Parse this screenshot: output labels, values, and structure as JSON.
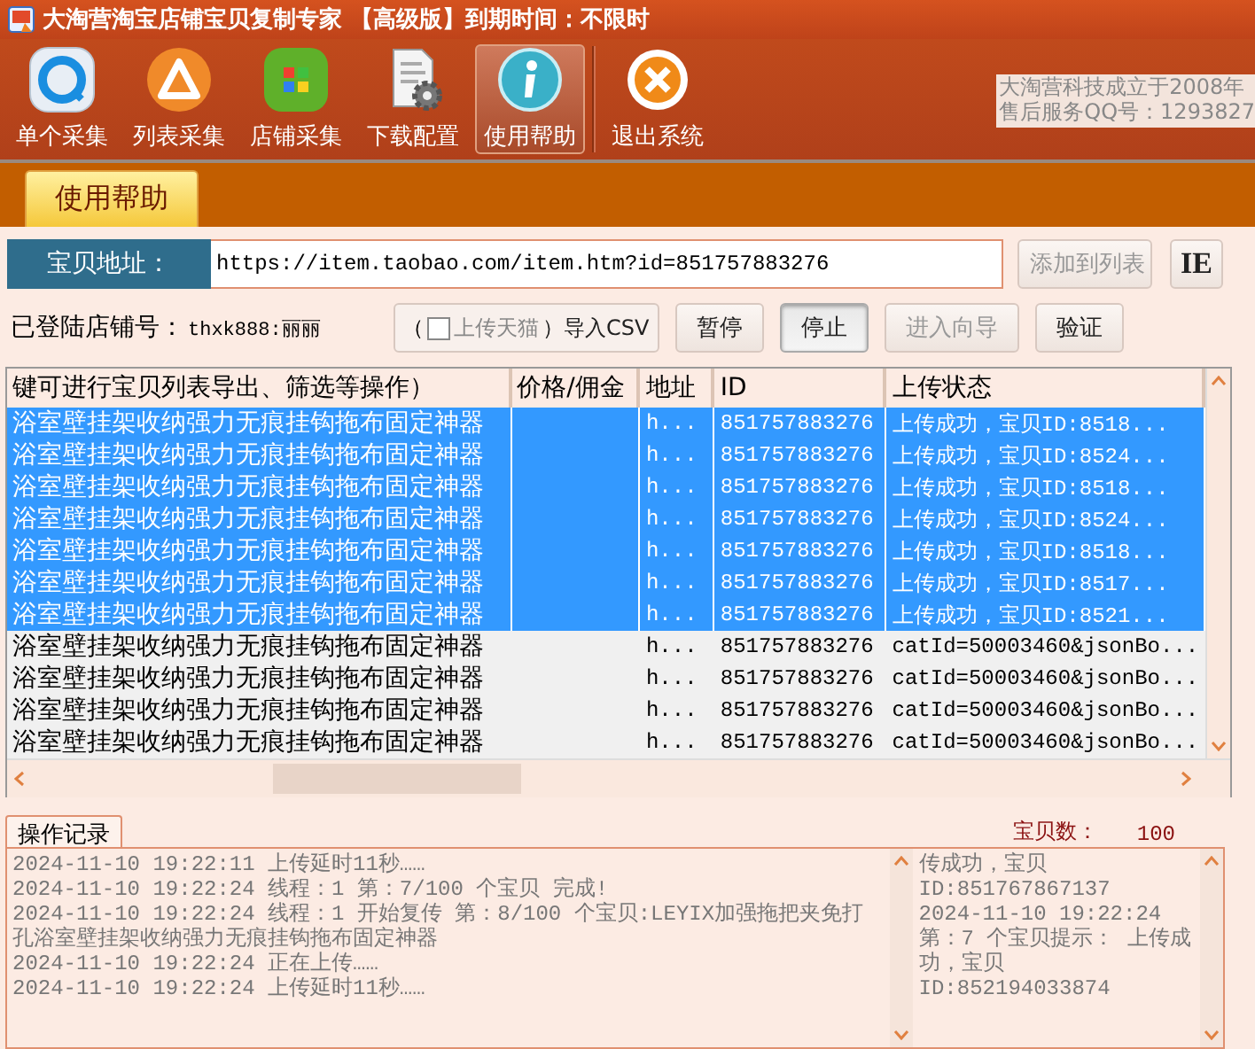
{
  "window": {
    "title": "大淘营淘宝店铺宝贝复制专家 【高级版】到期时间：不限时"
  },
  "toolbar": {
    "buttons": [
      {
        "label": "单个采集",
        "kind": "search",
        "selected": false
      },
      {
        "label": "列表采集",
        "kind": "triangle",
        "selected": false
      },
      {
        "label": "店铺采集",
        "kind": "grid",
        "selected": false
      },
      {
        "label": "下载配置",
        "kind": "document",
        "selected": false
      },
      {
        "label": "使用帮助",
        "kind": "info",
        "selected": true
      },
      {
        "label": "退出系统",
        "kind": "close",
        "selected": false
      }
    ],
    "notice": [
      "大淘营科技成立于2008年",
      "售后服务QQ号：1293827"
    ]
  },
  "tabs": [
    {
      "label": "使用帮助",
      "selected": true
    }
  ],
  "url_field": {
    "label": "宝贝地址：",
    "value": "https://item.taobao.com/item.htm?id=851757883276"
  },
  "add_button": {
    "label": "添加到列表",
    "disabled": true
  },
  "ie_button": {
    "label": "IE"
  },
  "shop": {
    "label": "已登陆店铺号：",
    "value": "thxk888:丽丽"
  },
  "import": {
    "prefix": "（",
    "checkbox_label": "上传天猫",
    "checked": false,
    "label": "）导入CSV"
  },
  "actions": [
    {
      "label": "暂停",
      "pressed": false,
      "disabled": false
    },
    {
      "label": "停止",
      "pressed": true,
      "disabled": false
    },
    {
      "label": "进入向导",
      "pressed": false,
      "disabled": true
    },
    {
      "label": "验证",
      "pressed": false,
      "disabled": false
    }
  ],
  "table": {
    "columns": [
      "键可进行宝贝列表导出、筛选等操作）",
      "价格/佣金",
      "地址",
      "ID",
      "上传状态"
    ],
    "rows": [
      {
        "name": "浴室壁挂架收纳强力无痕挂钩拖布固定神器",
        "address": "h...",
        "id": "851757883276",
        "status": "上传成功，宝贝ID:8518...",
        "selected": true
      },
      {
        "name": "浴室壁挂架收纳强力无痕挂钩拖布固定神器",
        "address": "h...",
        "id": "851757883276",
        "status": "上传成功，宝贝ID:8524...",
        "selected": true
      },
      {
        "name": "浴室壁挂架收纳强力无痕挂钩拖布固定神器",
        "address": "h...",
        "id": "851757883276",
        "status": "上传成功，宝贝ID:8518...",
        "selected": true
      },
      {
        "name": "浴室壁挂架收纳强力无痕挂钩拖布固定神器",
        "address": "h...",
        "id": "851757883276",
        "status": "上传成功，宝贝ID:8524...",
        "selected": true
      },
      {
        "name": "浴室壁挂架收纳强力无痕挂钩拖布固定神器",
        "address": "h...",
        "id": "851757883276",
        "status": "上传成功，宝贝ID:8518...",
        "selected": true
      },
      {
        "name": "浴室壁挂架收纳强力无痕挂钩拖布固定神器",
        "address": "h...",
        "id": "851757883276",
        "status": "上传成功，宝贝ID:8517...",
        "selected": true
      },
      {
        "name": "浴室壁挂架收纳强力无痕挂钩拖布固定神器",
        "address": "h...",
        "id": "851757883276",
        "status": "上传成功，宝贝ID:8521...",
        "selected": true
      },
      {
        "name": "浴室壁挂架收纳强力无痕挂钩拖布固定神器",
        "address": "h...",
        "id": "851757883276",
        "status": "catId=50003460&jsonBo...",
        "selected": false
      },
      {
        "name": "浴室壁挂架收纳强力无痕挂钩拖布固定神器",
        "address": "h...",
        "id": "851757883276",
        "status": "catId=50003460&jsonBo...",
        "selected": false
      },
      {
        "name": "浴室壁挂架收纳强力无痕挂钩拖布固定神器",
        "address": "h...",
        "id": "851757883276",
        "status": "catId=50003460&jsonBo...",
        "selected": false
      },
      {
        "name": "浴室壁挂架收纳强力无痕挂钩拖布固定神器",
        "address": "h...",
        "id": "851757883276",
        "status": "catId=50003460&jsonBo...",
        "selected": false
      }
    ]
  },
  "log": {
    "tab": "操作记录",
    "count_label": "宝贝数：",
    "count": "100",
    "lines": [
      "2024-11-10 19:22:11 上传延时11秒……",
      "2024-11-10 19:22:24 线程：1 第：7/100 个宝贝 完成!",
      "2024-11-10 19:22:24 线程：1  开始复传 第：8/100 个宝贝:LEYIX加强拖把夹免打孔浴室壁挂架收纳强力无痕挂钩拖布固定神器",
      "2024-11-10 19:22:24 正在上传……",
      "2024-11-10 19:22:24 上传延时11秒……"
    ],
    "side_lines": [
      "传成功，宝贝",
      "ID:851767867137",
      "2024-11-10 19:22:24",
      "第：7 个宝贝提示： 上传成功，宝贝",
      "ID:852194033874"
    ]
  }
}
